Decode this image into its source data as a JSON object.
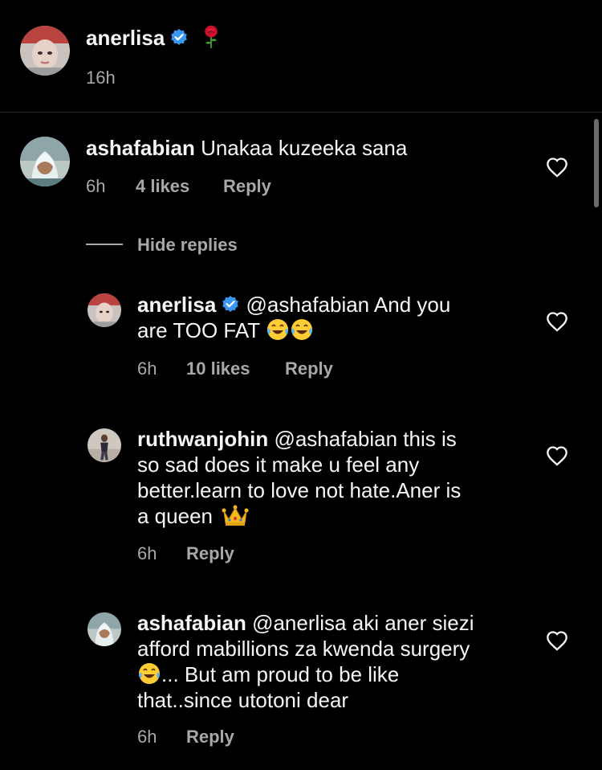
{
  "caption": {
    "username": "anerlisa",
    "time": "16h",
    "emoji": "rose-emoji"
  },
  "comments": [
    {
      "username": "ashafabian",
      "text": "Unakaa kuzeeka sana",
      "time": "6h",
      "likes": "4 likes",
      "reply": "Reply"
    }
  ],
  "hide_replies": "Hide replies",
  "replies": [
    {
      "username": "anerlisa",
      "verified": true,
      "line1": "@ashafabian And you",
      "line2": "are TOO FAT",
      "time": "6h",
      "likes": "10 likes",
      "reply": "Reply"
    },
    {
      "username": "ruthwanjohin",
      "line1": "@ashafabian this is",
      "line2": "so sad does it make u feel any",
      "line3": "better.learn to love  not hate.Aner is",
      "line4": "a queen",
      "time": "6h",
      "reply": "Reply"
    },
    {
      "username": "ashafabian",
      "line1": "@anerlisa aki aner siezi",
      "line2": "afford mabillions za kwenda surgery",
      "line3": "... But am proud to be like",
      "line4": "that..since utotoni dear",
      "time": "6h",
      "reply": "Reply"
    }
  ],
  "colors": {
    "background": "#000000",
    "text": "#f5f5f5",
    "secondary": "#a8a8a8",
    "verified": "#3897f0"
  }
}
